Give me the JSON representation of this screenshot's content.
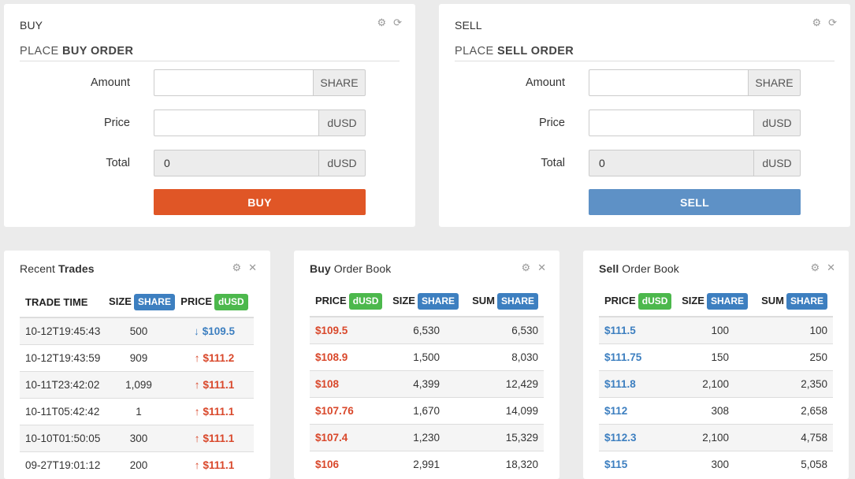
{
  "buy_panel": {
    "title": "BUY",
    "subtitle_prefix": "PLACE ",
    "subtitle_bold": "BUY ORDER",
    "amount_label": "Amount",
    "amount_value": "",
    "amount_unit": "SHARE",
    "price_label": "Price",
    "price_value": "",
    "price_unit": "dUSD",
    "total_label": "Total",
    "total_value": "0",
    "total_unit": "dUSD",
    "button_label": "BUY"
  },
  "sell_panel": {
    "title": "SELL",
    "subtitle_prefix": "PLACE ",
    "subtitle_bold": "SELL ORDER",
    "amount_label": "Amount",
    "amount_value": "",
    "amount_unit": "SHARE",
    "price_label": "Price",
    "price_value": "",
    "price_unit": "dUSD",
    "total_label": "Total",
    "total_value": "0",
    "total_unit": "dUSD",
    "button_label": "SELL"
  },
  "recent_trades": {
    "title_prefix": "Recent ",
    "title_bold": "Trades",
    "col_time": "TRADE TIME",
    "col_size": "SIZE",
    "col_size_badge": "SHARE",
    "col_price": "PRICE",
    "col_price_badge": "dUSD",
    "rows": [
      {
        "time": "10-12T19:45:43",
        "size": "500",
        "price": "$109.5",
        "dir": "down"
      },
      {
        "time": "10-12T19:43:59",
        "size": "909",
        "price": "$111.2",
        "dir": "up"
      },
      {
        "time": "10-11T23:42:02",
        "size": "1,099",
        "price": "$111.1",
        "dir": "up"
      },
      {
        "time": "10-11T05:42:42",
        "size": "1",
        "price": "$111.1",
        "dir": "up"
      },
      {
        "time": "10-10T01:50:05",
        "size": "300",
        "price": "$111.1",
        "dir": "up"
      },
      {
        "time": "09-27T19:01:12",
        "size": "200",
        "price": "$111.1",
        "dir": "up"
      }
    ]
  },
  "buy_book": {
    "title_bold": "Buy",
    "title_rest": " Order Book",
    "col_price": "PRICE",
    "col_price_badge": "dUSD",
    "col_size": "SIZE",
    "col_size_badge": "SHARE",
    "col_sum": "SUM",
    "col_sum_badge": "SHARE",
    "rows": [
      {
        "price": "$109.5",
        "size": "6,530",
        "sum": "6,530"
      },
      {
        "price": "$108.9",
        "size": "1,500",
        "sum": "8,030"
      },
      {
        "price": "$108",
        "size": "4,399",
        "sum": "12,429"
      },
      {
        "price": "$107.76",
        "size": "1,670",
        "sum": "14,099"
      },
      {
        "price": "$107.4",
        "size": "1,230",
        "sum": "15,329"
      },
      {
        "price": "$106",
        "size": "2,991",
        "sum": "18,320"
      }
    ]
  },
  "sell_book": {
    "title_bold": "Sell",
    "title_rest": " Order Book",
    "col_price": "PRICE",
    "col_price_badge": "dUSD",
    "col_size": "SIZE",
    "col_size_badge": "SHARE",
    "col_sum": "SUM",
    "col_sum_badge": "SHARE",
    "rows": [
      {
        "price": "$111.5",
        "size": "100",
        "sum": "100"
      },
      {
        "price": "$111.75",
        "size": "150",
        "sum": "250"
      },
      {
        "price": "$111.8",
        "size": "2,100",
        "sum": "2,350"
      },
      {
        "price": "$112",
        "size": "308",
        "sum": "2,658"
      },
      {
        "price": "$112.3",
        "size": "2,100",
        "sum": "4,758"
      },
      {
        "price": "$115",
        "size": "300",
        "sum": "5,058"
      }
    ]
  },
  "colors": {
    "buy": "#e05626",
    "sell": "#5e91c6",
    "badge_blue": "#3d7fc0",
    "badge_green": "#4cb84c"
  },
  "icons": {
    "settings": "gear-icon",
    "refresh": "refresh-icon",
    "close": "close-icon",
    "up": "arrow-up-icon",
    "down": "arrow-down-icon"
  }
}
